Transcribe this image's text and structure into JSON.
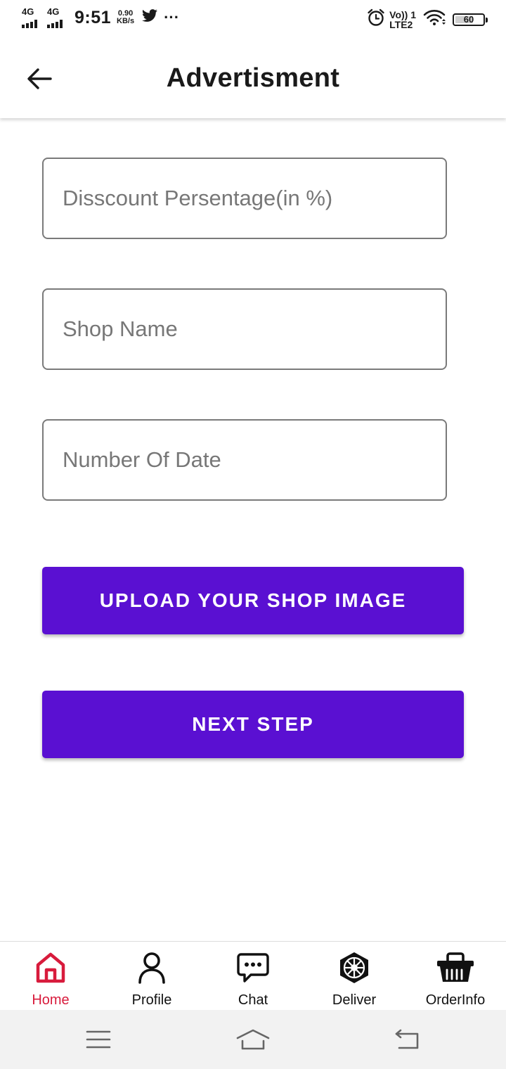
{
  "status_bar": {
    "network_1": "4G",
    "network_2": "4G",
    "time": "9:51",
    "speed_value": "0.90",
    "speed_unit": "KB/s",
    "more": "···",
    "volte_top": "Vo)) 1",
    "volte_bottom": "LTE2",
    "battery": "60"
  },
  "app_bar": {
    "title": "Advertisment"
  },
  "form": {
    "discount_placeholder": "Disscount Persentage(in %)",
    "shop_name_placeholder": "Shop Name",
    "number_of_date_placeholder": "Number Of Date",
    "upload_label": "UPLOAD YOUR SHOP IMAGE",
    "next_label": "NEXT STEP"
  },
  "bottom_nav": {
    "active": "home",
    "active_color": "#d81b3c",
    "items": [
      {
        "label": "Home",
        "icon": "home-icon"
      },
      {
        "label": "Profile",
        "icon": "person-icon"
      },
      {
        "label": "Chat",
        "icon": "chat-bubble-icon"
      },
      {
        "label": "Deliver",
        "icon": "hex-emblem-icon"
      },
      {
        "label": "OrderInfo",
        "icon": "basket-icon"
      }
    ]
  },
  "colors": {
    "primary_button": "#5a10d2",
    "field_border": "#7a7a7a",
    "placeholder": "#777777"
  }
}
